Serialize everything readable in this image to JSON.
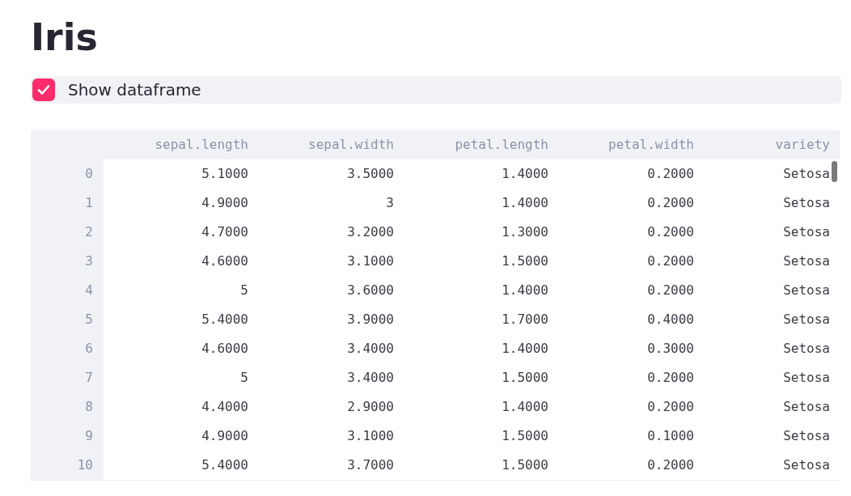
{
  "title": "Iris",
  "checkbox": {
    "label": "Show dataframe",
    "checked": true
  },
  "table": {
    "columns": [
      "sepal.length",
      "sepal.width",
      "petal.length",
      "petal.width",
      "variety"
    ],
    "rows": [
      {
        "index": "0",
        "cells": [
          "5.1000",
          "3.5000",
          "1.4000",
          "0.2000",
          "Setosa"
        ]
      },
      {
        "index": "1",
        "cells": [
          "4.9000",
          "3",
          "1.4000",
          "0.2000",
          "Setosa"
        ]
      },
      {
        "index": "2",
        "cells": [
          "4.7000",
          "3.2000",
          "1.3000",
          "0.2000",
          "Setosa"
        ]
      },
      {
        "index": "3",
        "cells": [
          "4.6000",
          "3.1000",
          "1.5000",
          "0.2000",
          "Setosa"
        ]
      },
      {
        "index": "4",
        "cells": [
          "5",
          "3.6000",
          "1.4000",
          "0.2000",
          "Setosa"
        ]
      },
      {
        "index": "5",
        "cells": [
          "5.4000",
          "3.9000",
          "1.7000",
          "0.4000",
          "Setosa"
        ]
      },
      {
        "index": "6",
        "cells": [
          "4.6000",
          "3.4000",
          "1.4000",
          "0.3000",
          "Setosa"
        ]
      },
      {
        "index": "7",
        "cells": [
          "5",
          "3.4000",
          "1.5000",
          "0.2000",
          "Setosa"
        ]
      },
      {
        "index": "8",
        "cells": [
          "4.4000",
          "2.9000",
          "1.4000",
          "0.2000",
          "Setosa"
        ]
      },
      {
        "index": "9",
        "cells": [
          "4.9000",
          "3.1000",
          "1.5000",
          "0.1000",
          "Setosa"
        ]
      },
      {
        "index": "10",
        "cells": [
          "5.4000",
          "3.7000",
          "1.5000",
          "0.2000",
          "Setosa"
        ]
      }
    ]
  }
}
